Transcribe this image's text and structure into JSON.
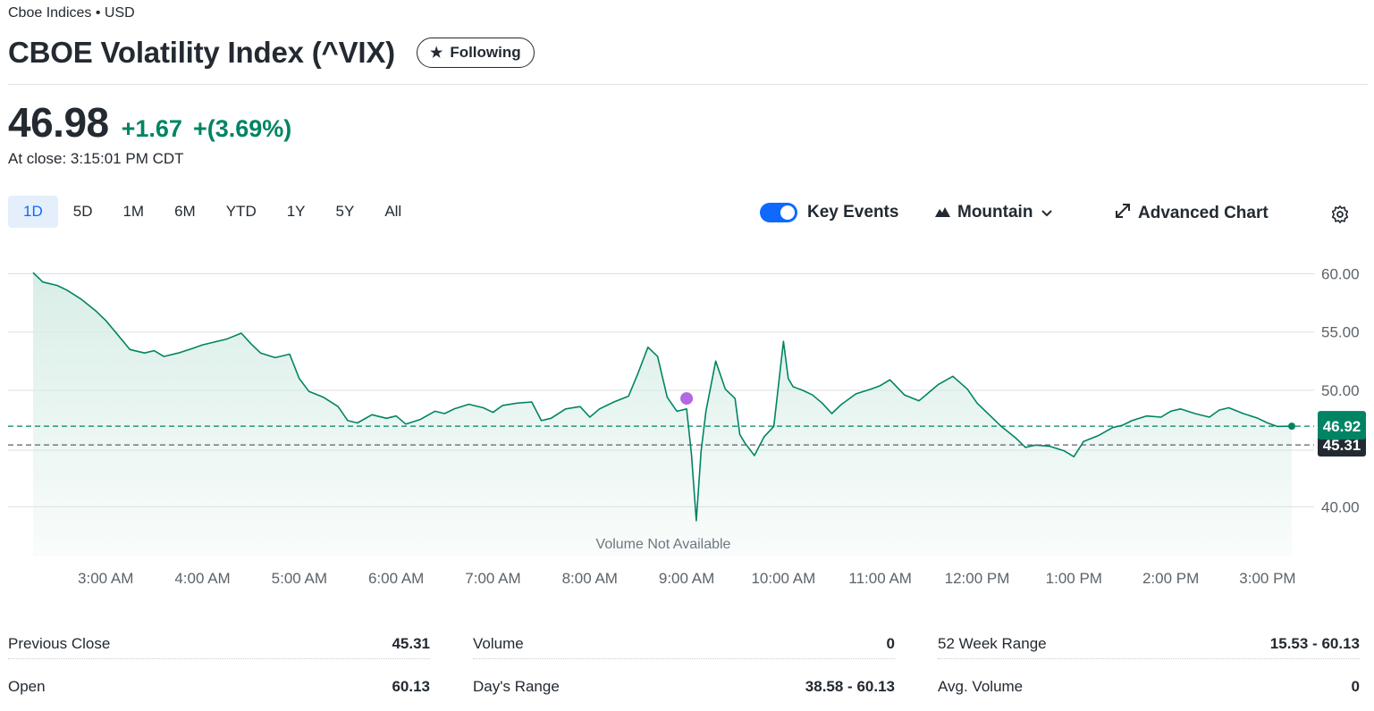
{
  "header": {
    "exchange_currency": "Cboe Indices • USD",
    "title": "CBOE Volatility Index (^VIX)",
    "follow_label": "Following"
  },
  "quote": {
    "price": "46.98",
    "change": "+1.67",
    "change_pct": "+(3.69%)",
    "close_time": "At close: 3:15:01 PM CDT",
    "change_color": "#008463"
  },
  "ranges": [
    "1D",
    "5D",
    "1M",
    "6M",
    "YTD",
    "1Y",
    "5Y",
    "All"
  ],
  "active_range": "1D",
  "toolbar": {
    "key_events_label": "Key Events",
    "chart_type_label": "Mountain",
    "advanced_label": "Advanced Chart"
  },
  "colors": {
    "accent": "#0f69ff",
    "line": "#008463",
    "fill": "#d7ede6",
    "event_marker": "#b168e0"
  },
  "chart_data": {
    "type": "area",
    "x_ticks": [
      "3:00 AM",
      "4:00 AM",
      "5:00 AM",
      "6:00 AM",
      "7:00 AM",
      "8:00 AM",
      "9:00 AM",
      "10:00 AM",
      "11:00 AM",
      "12:00 PM",
      "1:00 PM",
      "2:00 PM",
      "3:00 PM"
    ],
    "y_ticks": [
      "60.00",
      "55.00",
      "50.00",
      "40.00"
    ],
    "ylim": [
      37.5,
      60.5
    ],
    "x_range_hours": [
      2.25,
      15.25
    ],
    "series": [
      {
        "x": [
          2.25,
          2.35,
          2.5,
          2.6,
          2.75,
          2.9,
          3.0,
          3.1,
          3.25,
          3.4,
          3.5,
          3.6,
          3.75,
          3.9,
          4.0,
          4.1,
          4.25,
          4.4,
          4.5,
          4.6,
          4.75,
          4.9,
          5.0,
          5.1,
          5.25,
          5.4,
          5.5,
          5.6,
          5.75,
          5.9,
          6.0,
          6.1,
          6.25,
          6.4,
          6.5,
          6.6,
          6.75,
          6.9,
          7.0,
          7.1,
          7.25,
          7.4,
          7.5,
          7.6,
          7.75,
          7.9,
          8.0,
          8.1,
          8.25,
          8.4,
          8.5,
          8.6,
          8.7,
          8.8,
          8.9,
          9.0,
          9.05,
          9.1,
          9.15,
          9.2,
          9.3,
          9.4,
          9.5,
          9.55,
          9.6,
          9.7,
          9.8,
          9.9,
          10.0,
          10.05,
          10.1,
          10.2,
          10.3,
          10.4,
          10.5,
          10.6,
          10.75,
          10.9,
          11.0,
          11.1,
          11.25,
          11.4,
          11.5,
          11.6,
          11.75,
          11.9,
          12.0,
          12.1,
          12.25,
          12.4,
          12.5,
          12.6,
          12.75,
          12.9,
          13.0,
          13.1,
          13.25,
          13.4,
          13.5,
          13.6,
          13.75,
          13.9,
          14.0,
          14.1,
          14.25,
          14.4,
          14.5,
          14.6,
          14.75,
          14.9,
          15.0,
          15.1,
          15.25
        ],
        "y": [
          60.1,
          59.3,
          59.0,
          58.6,
          57.8,
          56.8,
          56.0,
          55.0,
          53.5,
          53.2,
          53.4,
          52.9,
          53.2,
          53.6,
          53.9,
          54.1,
          54.4,
          54.9,
          54.0,
          53.2,
          52.8,
          53.1,
          51.0,
          49.9,
          49.4,
          48.6,
          47.4,
          47.2,
          47.9,
          47.6,
          47.8,
          47.1,
          47.5,
          48.2,
          48.0,
          48.4,
          48.8,
          48.5,
          48.1,
          48.7,
          48.9,
          49.0,
          47.4,
          47.6,
          48.4,
          48.6,
          47.7,
          48.4,
          49.0,
          49.5,
          51.5,
          53.7,
          52.9,
          49.4,
          48.2,
          48.4,
          44.5,
          38.8,
          44.8,
          48.2,
          52.5,
          50.1,
          49.3,
          46.2,
          45.5,
          44.4,
          46.0,
          46.9,
          54.2,
          51.0,
          50.3,
          50.0,
          49.6,
          48.9,
          48.0,
          48.8,
          49.7,
          50.1,
          50.4,
          50.9,
          49.6,
          49.1,
          49.8,
          50.5,
          51.2,
          50.1,
          48.9,
          48.1,
          46.9,
          45.9,
          45.1,
          45.3,
          45.2,
          44.8,
          44.3,
          45.6,
          46.1,
          46.8,
          47.0,
          47.4,
          47.8,
          47.7,
          48.2,
          48.4,
          48.0,
          47.7,
          48.3,
          48.5,
          48.0,
          47.6,
          47.2,
          46.9,
          46.92
        ]
      }
    ],
    "event_marker": {
      "x": 9.0,
      "y": 49.3
    },
    "reference_lines": {
      "current": 46.92,
      "previous_close": 45.31
    },
    "current_label": "46.92",
    "previous_close_label": "45.31",
    "volume_note": "Volume Not Available"
  },
  "stats": [
    [
      {
        "label": "Previous Close",
        "value": "45.31"
      },
      {
        "label": "Open",
        "value": "60.13"
      }
    ],
    [
      {
        "label": "Volume",
        "value": "0"
      },
      {
        "label": "Day's Range",
        "value": "38.58 - 60.13"
      }
    ],
    [
      {
        "label": "52 Week Range",
        "value": "15.53 - 60.13"
      },
      {
        "label": "Avg. Volume",
        "value": "0"
      }
    ]
  ]
}
